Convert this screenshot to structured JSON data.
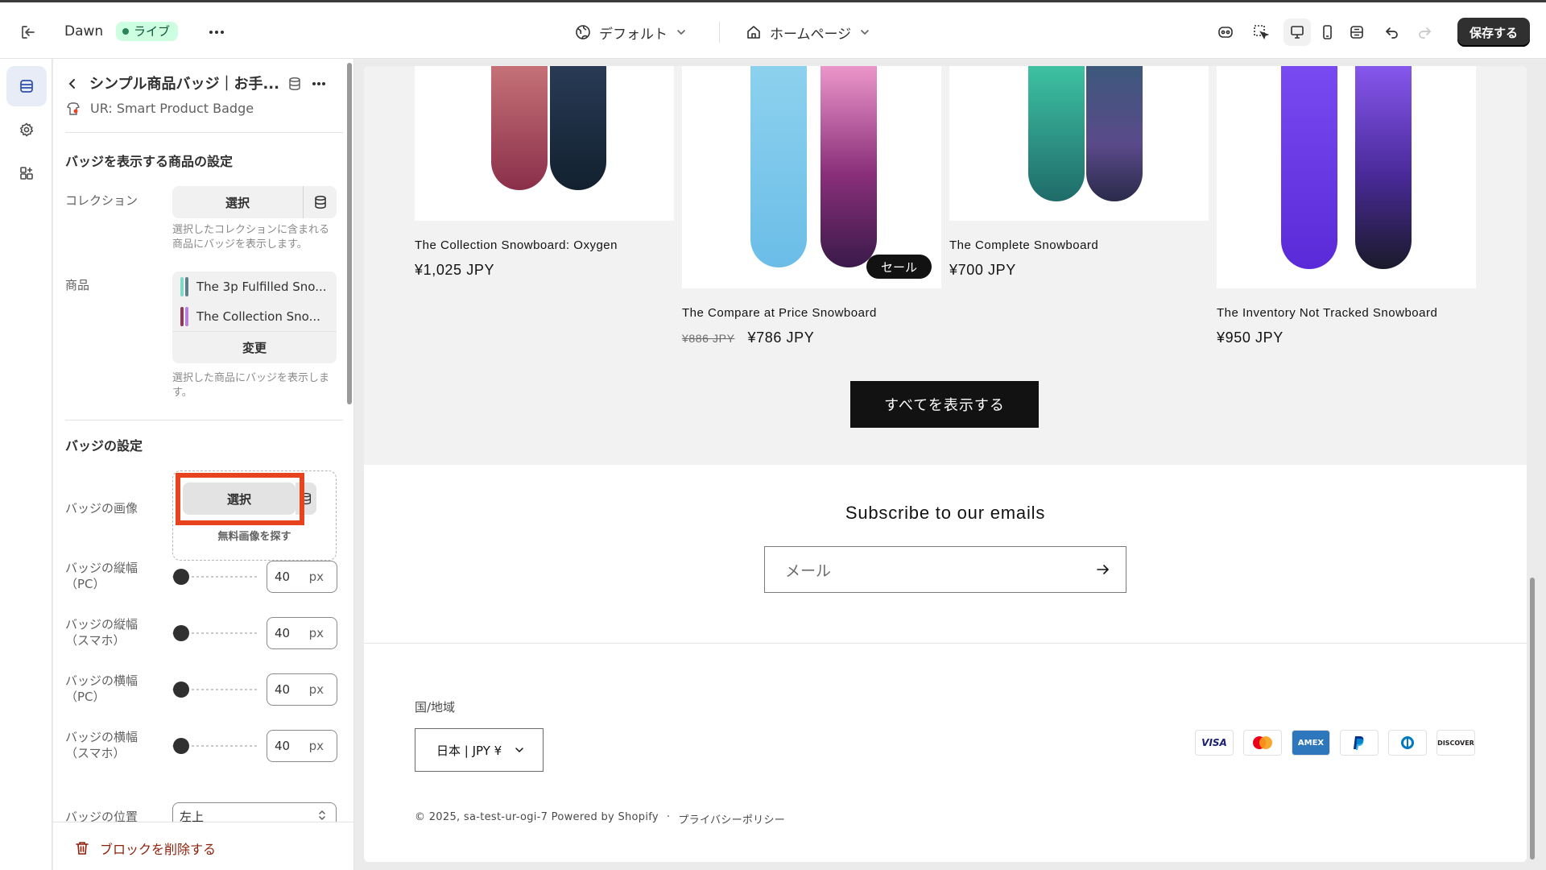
{
  "topbar": {
    "theme_name": "Dawn",
    "live_badge": "ライブ",
    "template": "デフォルト",
    "page": "ホームページ",
    "save_label": "保存する"
  },
  "panel": {
    "title": "シンプル商品バッジ｜お手...",
    "app_name": "UR: Smart Product Badge",
    "product_section_heading": "バッジを表示する商品の設定",
    "collection_label": "コレクション",
    "collection_button": "選択",
    "collection_help": "選択したコレクションに含まれる商品にバッジを表示します。",
    "products_label": "商品",
    "products": [
      {
        "name": "The 3p Fulfilled Sno..."
      },
      {
        "name": "The Collection Sno..."
      }
    ],
    "change_button": "変更",
    "products_help": "選択した商品にバッジを表示します。",
    "badge_section_heading": "バッジの設定",
    "badge_image_label": "バッジの画像",
    "badge_image_button": "選択",
    "free_images_link": "無料画像を探す",
    "sliders": [
      {
        "label": "バッジの縦幅（PC）",
        "value": "40",
        "unit": "px"
      },
      {
        "label": "バッジの縦幅（スマホ）",
        "value": "40",
        "unit": "px"
      },
      {
        "label": "バッジの横幅（PC）",
        "value": "40",
        "unit": "px"
      },
      {
        "label": "バッジの横幅（スマホ）",
        "value": "40",
        "unit": "px"
      }
    ],
    "position_label": "バッジの位置",
    "position_value": "左上",
    "delete_label": "ブロックを削除する"
  },
  "preview": {
    "products": [
      {
        "name": "The Collection Snowboard: Oxygen",
        "price": "¥1,025 JPY"
      },
      {
        "name": "The Compare at Price Snowboard",
        "compare_price": "¥886 JPY",
        "price": "¥786 JPY",
        "badge": "セール"
      },
      {
        "name": "The Complete Snowboard",
        "price": "¥700 JPY"
      },
      {
        "name": "The Inventory Not Tracked Snowboard",
        "price": "¥950 JPY"
      }
    ],
    "view_all": "すべてを表示する",
    "subscribe_title": "Subscribe to our emails",
    "email_placeholder": "メール",
    "country_label": "国/地域",
    "country_value": "日本 | JPY ¥",
    "payment_methods": [
      "VISA",
      "Mastercard",
      "AMEX",
      "PayPal",
      "Diners",
      "DISCOVER"
    ],
    "copyright": "© 2025, sa-test-ur-ogi-7 Powered by Shopify",
    "separator": "·",
    "privacy_policy": "プライバシーポリシー"
  },
  "colors": {
    "live_badge_bg": "#cdfee1",
    "save_button_bg": "#303030",
    "highlight_border": "#e8431f",
    "delete_text": "#8e1f0b"
  }
}
